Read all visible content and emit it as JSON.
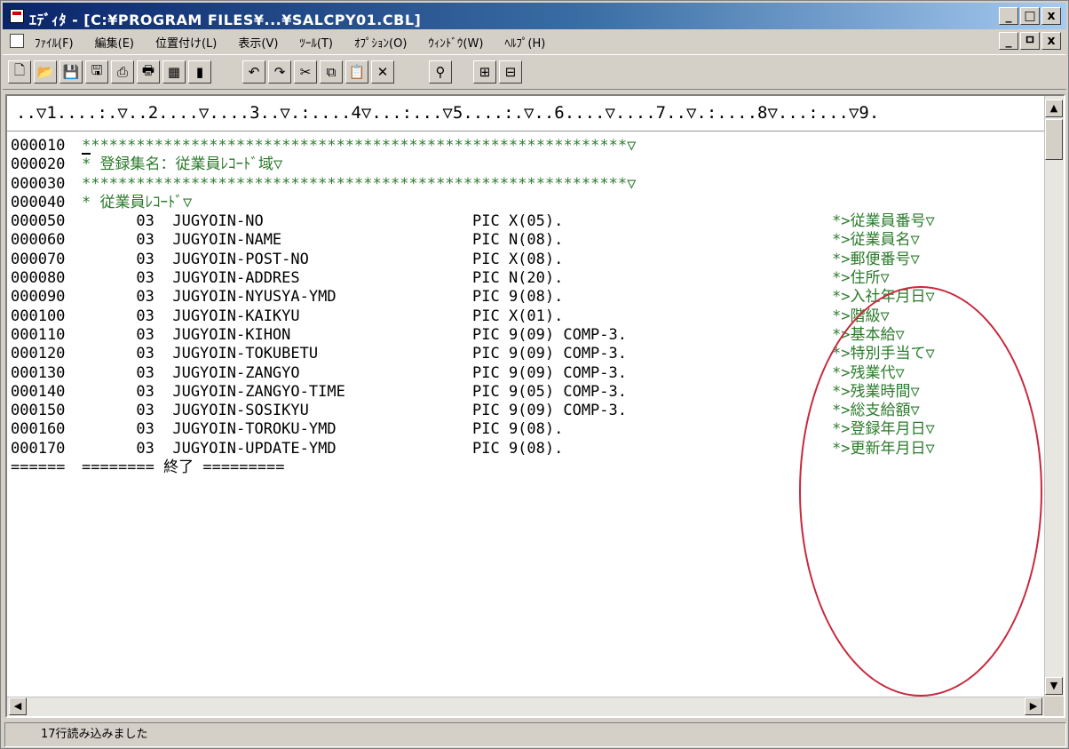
{
  "window": {
    "title": "ｴﾃﾞｨﾀ - [C:¥PROGRAM FILES¥...¥SALCPY01.CBL]",
    "caption_buttons": [
      "_",
      "□",
      "x"
    ],
    "mdi_buttons": [
      "_",
      "ㅁ",
      "x"
    ]
  },
  "menu": {
    "items": [
      "ﾌｧｲﾙ(F)",
      "編集(E)",
      "位置付け(L)",
      "表示(V)",
      "ﾂｰﾙ(T)",
      "ｵﾌﾟｼｮﾝ(O)",
      "ｳｨﾝﾄﾞｳ(W)",
      "ﾍﾙﾌﾟ(H)"
    ]
  },
  "toolbar": {
    "icons": [
      "new-file-icon",
      "open-folder-icon",
      "save-icon",
      "save-all-icon",
      "print-preview-icon",
      "print-icon",
      "grid-icon",
      "book-icon",
      "undo-icon",
      "redo-icon",
      "cut-icon",
      "copy-icon",
      "paste-icon",
      "delete-icon",
      "find-icon",
      "window-icon",
      "compare-icon"
    ],
    "glyphs": [
      "🗋",
      "📂",
      "💾",
      "🖫",
      "⎙",
      "🖶",
      "▦",
      "▮",
      "↶",
      "↷",
      "✂",
      "⧉",
      "📋",
      "✕",
      "⚲",
      "⊞",
      "⊟"
    ]
  },
  "editor": {
    "ruler": "..▽1....:.▽..2....▽....3..▽.:....4▽...:...▽5....:.▽..6....▽....7..▽.:....8▽...:...▽9.",
    "lines": [
      {
        "num": "000010",
        "code": "************************************************************▽",
        "pic": "",
        "comment": "",
        "green": true,
        "cursor": true
      },
      {
        "num": "000020",
        "code": "* 登録集名：従業員ﾚｺｰﾄﾞ域▽",
        "pic": "",
        "comment": "",
        "green": true
      },
      {
        "num": "000030",
        "code": "************************************************************▽",
        "pic": "",
        "comment": "",
        "green": true
      },
      {
        "num": "000040",
        "code": "* 従業員ﾚｺｰﾄﾞ▽",
        "pic": "",
        "comment": "",
        "green": true
      },
      {
        "num": "000050",
        "code": "      03  JUGYOIN-NO",
        "pic": "PIC X(05).",
        "comment": "*>従業員番号▽"
      },
      {
        "num": "000060",
        "code": "      03  JUGYOIN-NAME",
        "pic": "PIC N(08).",
        "comment": "*>従業員名▽"
      },
      {
        "num": "000070",
        "code": "      03  JUGYOIN-POST-NO",
        "pic": "PIC X(08).",
        "comment": "*>郵便番号▽"
      },
      {
        "num": "000080",
        "code": "      03  JUGYOIN-ADDRES",
        "pic": "PIC N(20).",
        "comment": "*>住所▽"
      },
      {
        "num": "000090",
        "code": "      03  JUGYOIN-NYUSYA-YMD",
        "pic": "PIC 9(08).",
        "comment": "*>入社年月日▽"
      },
      {
        "num": "000100",
        "code": "      03  JUGYOIN-KAIKYU",
        "pic": "PIC X(01).",
        "comment": "*>階級▽"
      },
      {
        "num": "000110",
        "code": "      03  JUGYOIN-KIHON",
        "pic": "PIC 9(09) COMP-3.",
        "comment": "*>基本給▽"
      },
      {
        "num": "000120",
        "code": "      03  JUGYOIN-TOKUBETU",
        "pic": "PIC 9(09) COMP-3.",
        "comment": "*>特別手当て▽"
      },
      {
        "num": "000130",
        "code": "      03  JUGYOIN-ZANGYO",
        "pic": "PIC 9(09) COMP-3.",
        "comment": "*>残業代▽"
      },
      {
        "num": "000140",
        "code": "      03  JUGYOIN-ZANGYO-TIME",
        "pic": "PIC 9(05) COMP-3.",
        "comment": "*>残業時間▽"
      },
      {
        "num": "000150",
        "code": "      03  JUGYOIN-SOSIKYU",
        "pic": "PIC 9(09) COMP-3.",
        "comment": "*>総支給額▽"
      },
      {
        "num": "000160",
        "code": "      03  JUGYOIN-TOROKU-YMD",
        "pic": "PIC 9(08).",
        "comment": "*>登録年月日▽"
      },
      {
        "num": "000170",
        "code": "      03  JUGYOIN-UPDATE-YMD",
        "pic": "PIC 9(08).",
        "comment": "*>更新年月日▽"
      },
      {
        "num": "======",
        "code": "======== 終了 =========",
        "pic": "",
        "comment": ""
      }
    ],
    "comment_color": "#2b7a2b",
    "annotation_color": "#c8283c"
  },
  "status": {
    "message": "17行読み込みました"
  }
}
